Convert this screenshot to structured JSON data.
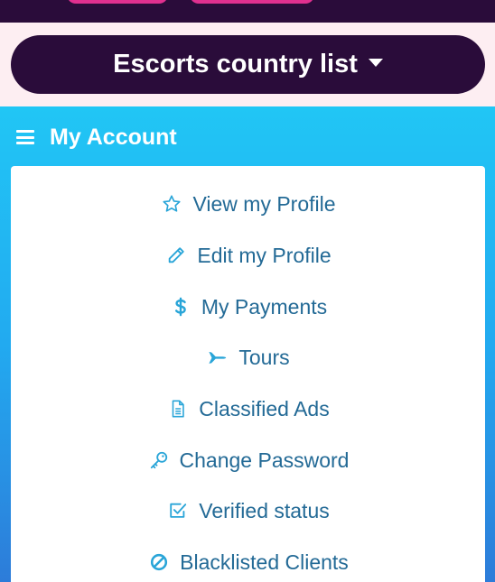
{
  "colors": {
    "dark": "#2a0c3a",
    "accent_pink": "#e0308f",
    "sky": "#21c6f5",
    "link": "#236a96",
    "icon": "#29a5d8"
  },
  "country_button": {
    "label": "Escorts country list",
    "icon": "caret-down-icon"
  },
  "account": {
    "title": "My Account",
    "icon": "hamburger-icon",
    "items": [
      {
        "label": "View my Profile",
        "icon": "star-icon"
      },
      {
        "label": "Edit my Profile",
        "icon": "pencil-icon"
      },
      {
        "label": "My Payments",
        "icon": "dollar-icon"
      },
      {
        "label": "Tours",
        "icon": "plane-icon"
      },
      {
        "label": "Classified Ads",
        "icon": "document-icon"
      },
      {
        "label": "Change Password",
        "icon": "key-icon"
      },
      {
        "label": "Verified status",
        "icon": "check-square-icon"
      },
      {
        "label": "Blacklisted Clients",
        "icon": "ban-icon"
      }
    ]
  }
}
